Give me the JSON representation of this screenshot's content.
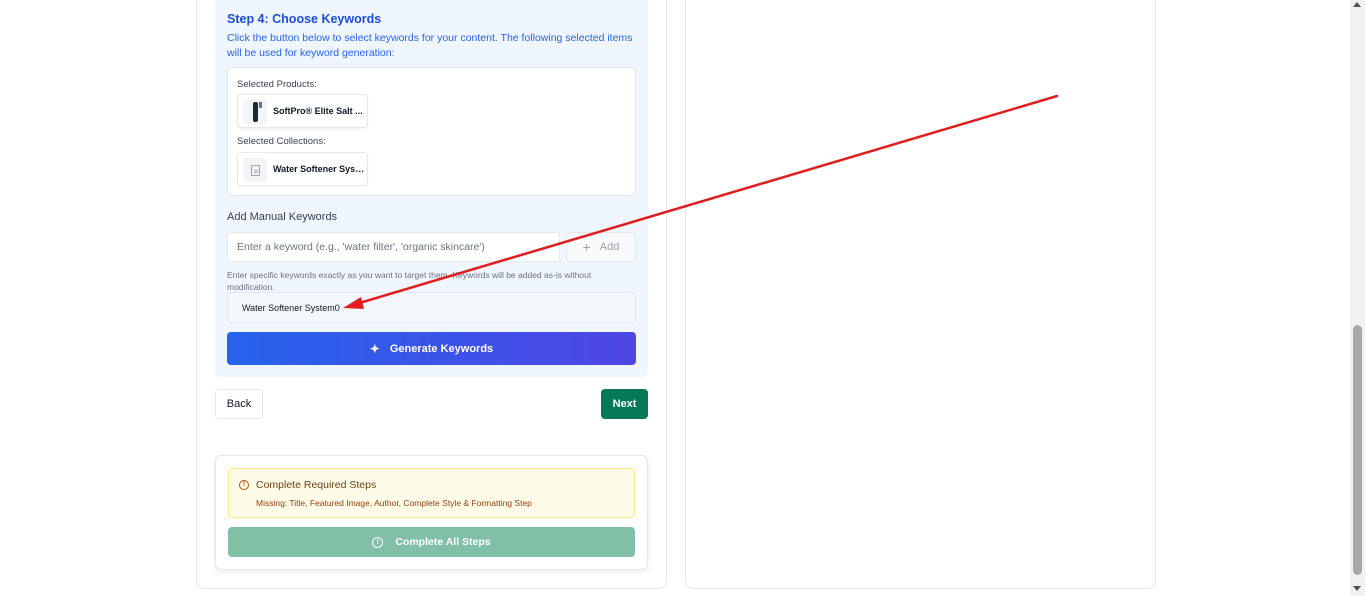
{
  "step": {
    "title": "Step 4: Choose Keywords",
    "description": "Click the button below to select keywords for your content. The following selected items will be used for keyword generation:"
  },
  "selected": {
    "products_label": "Selected Products:",
    "product_name": "SoftPro® Elite Salt ...",
    "collections_label": "Selected Collections:",
    "collection_name": "Water Softener Syst..."
  },
  "manual": {
    "label": "Add Manual Keywords",
    "placeholder": "Enter a keyword (e.g., 'water filter', 'organic skincare')",
    "value": "",
    "add_label": "Add",
    "help": "Enter specific keywords exactly as you want to target them. Keywords will be added as-is without modification.",
    "keywords": [
      "Water Softener System0"
    ]
  },
  "generate_label": "Generate Keywords",
  "nav": {
    "back_label": "Back",
    "next_label": "Next"
  },
  "requirements": {
    "title": "Complete Required Steps",
    "detail": "Missing: Title, Featured Image, Author, Complete Style & Formatting Step",
    "button_label": "Complete All Steps"
  },
  "colors": {
    "accent": "#2563eb",
    "next": "#047857",
    "annotation_arrow": "#e11d1d",
    "warning_bg": "#fefce8"
  },
  "icons": [
    "plus-icon",
    "sparkle-icon",
    "warning-icon",
    "info-icon",
    "document-icon",
    "product-thumbnail"
  ]
}
